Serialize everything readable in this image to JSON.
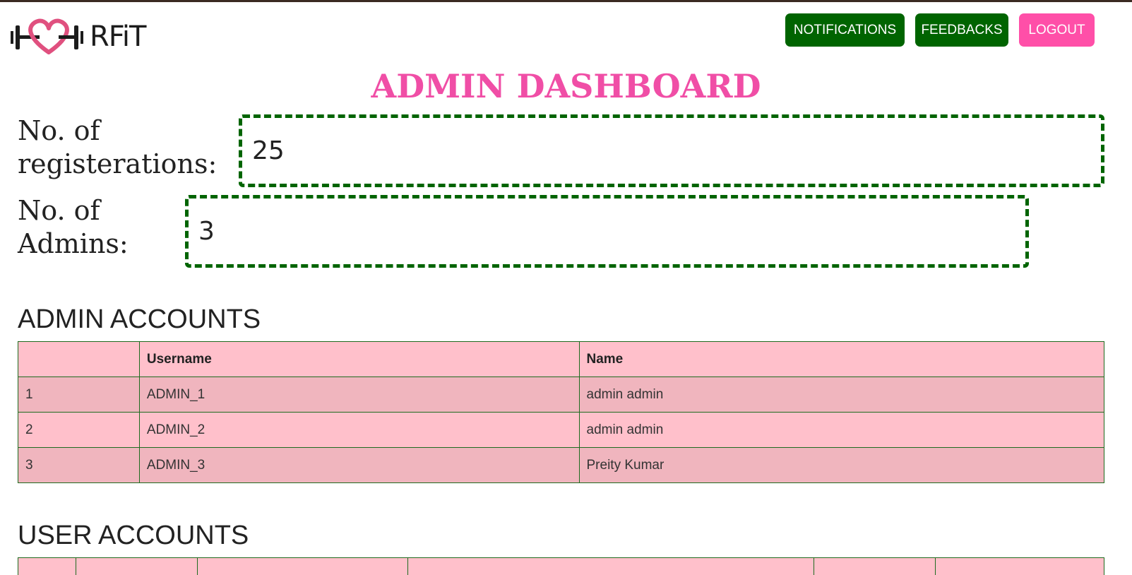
{
  "brand": {
    "logo_text": "RFiT",
    "colors": {
      "pink": "#f04ea6",
      "green": "#006400",
      "table_bg": "#ffc0cb"
    }
  },
  "nav": {
    "notifications_label": "NOTIFICATIONS",
    "feedbacks_label": "FEEDBACKS",
    "logout_label": "LOGOUT"
  },
  "page": {
    "title": "ADMIN DASHBOARD"
  },
  "stats": {
    "registrations": {
      "label_line1": "No. of",
      "label_line2": "registerations:",
      "value": "25"
    },
    "admins": {
      "label_line1": "No. of",
      "label_line2": "Admins:",
      "value": "3"
    }
  },
  "admin_accounts": {
    "heading": "ADMIN ACCOUNTS",
    "columns": [
      "",
      "Username",
      "Name"
    ],
    "rows": [
      [
        "1",
        "ADMIN_1",
        "admin admin"
      ],
      [
        "2",
        "ADMIN_2",
        "admin admin"
      ],
      [
        "3",
        "ADMIN_3",
        "Preity Kumar"
      ]
    ]
  },
  "user_accounts": {
    "heading": "USER ACCOUNTS"
  }
}
